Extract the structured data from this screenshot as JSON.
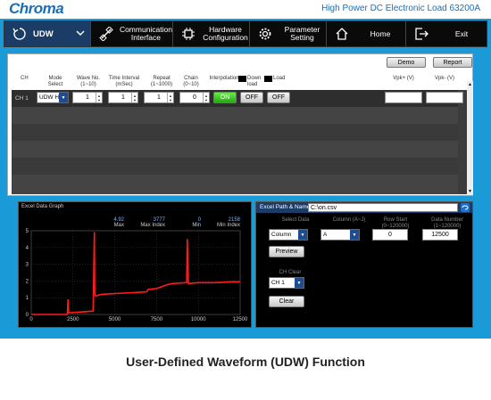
{
  "header": {
    "logo": "Chroma",
    "product": "High Power DC Electronic Load 63200A"
  },
  "menu": {
    "mode": "UDW",
    "communication": "Communication Interface",
    "hardware": "Hardware Configuration",
    "parameter": "Parameter Setting",
    "home": "Home",
    "exit": "Exit"
  },
  "toolbar": {
    "demo": "Demo",
    "report": "Report"
  },
  "table_headers": {
    "ch": "CH",
    "mode": "Mode Select",
    "wave": "Wave No. (1~10)",
    "interval": "Time Interval (mSec)",
    "repeat": "Repeat (1~1000)",
    "chain": "Chain (0~10)",
    "interpolation": "Interpolation",
    "down_load": "Down load",
    "load": "Load",
    "vpk_plus": "Vpk+ (V)",
    "vpk_minus": "Vpk- (V)"
  },
  "channel_row": {
    "ch": "CH 1",
    "mode": "UDW H",
    "wave": "1",
    "interval": "1",
    "repeat": "1",
    "chain": "0",
    "on": "ON",
    "off1": "OFF",
    "off2": "OFF",
    "vpk_plus": "",
    "vpk_minus": ""
  },
  "graph": {
    "title": "Excel Data Graph",
    "stats": [
      {
        "value": "4.92",
        "label": "Max"
      },
      {
        "value": "3777",
        "label": "Max Index"
      },
      {
        "value": "0",
        "label": "Min"
      },
      {
        "value": "2158",
        "label": "Min Index"
      }
    ]
  },
  "chart_data": {
    "type": "line",
    "title": "",
    "xlim": [
      0,
      12500
    ],
    "ylim": [
      0,
      5
    ],
    "x_ticks": [
      "0",
      "2500",
      "5000",
      "7500",
      "10000",
      "12500"
    ],
    "y_ticks": [
      "0",
      "1",
      "2",
      "3",
      "4",
      "5"
    ],
    "grid": true,
    "line_color": "#ff1a1a",
    "series": [
      {
        "x": [
          0,
          2158,
          2200,
          2240,
          2300,
          3700,
          3777,
          3800,
          3850,
          4200,
          5000,
          6000,
          6900,
          7000,
          7500,
          8200,
          8500,
          9300,
          9340,
          9400,
          10000,
          11000,
          12000,
          12500
        ],
        "y": [
          0,
          0,
          0.9,
          0.1,
          0.1,
          0.2,
          4.92,
          1.2,
          1.1,
          1.2,
          1.25,
          1.3,
          1.35,
          1.5,
          1.55,
          1.8,
          1.85,
          1.9,
          4.5,
          1.85,
          1.9,
          1.9,
          1.95,
          1.95
        ]
      }
    ]
  },
  "excel": {
    "path_label": "Excel Path & Name",
    "path_value": "C:\\on.csv",
    "select_data": "Select Data",
    "column_label": "Column (A~J)",
    "row_start_label": "Row Start (0~120000)",
    "data_number_label": "Data Number (1~120000)",
    "select_value": "Column",
    "column_value": "A",
    "row_start_value": "0",
    "data_number_value": "12500",
    "preview": "Preview",
    "ch_clear_label": "CH Clear",
    "ch_clear_value": "CH 1",
    "clear": "Clear"
  },
  "caption": "User-Defined Waveform (UDW) Function",
  "colors": {
    "frame": "#1a9bd8",
    "brand": "#1a6fb8",
    "on_green": "#33cc33",
    "dropdown_blue": "#1e4c8e"
  }
}
